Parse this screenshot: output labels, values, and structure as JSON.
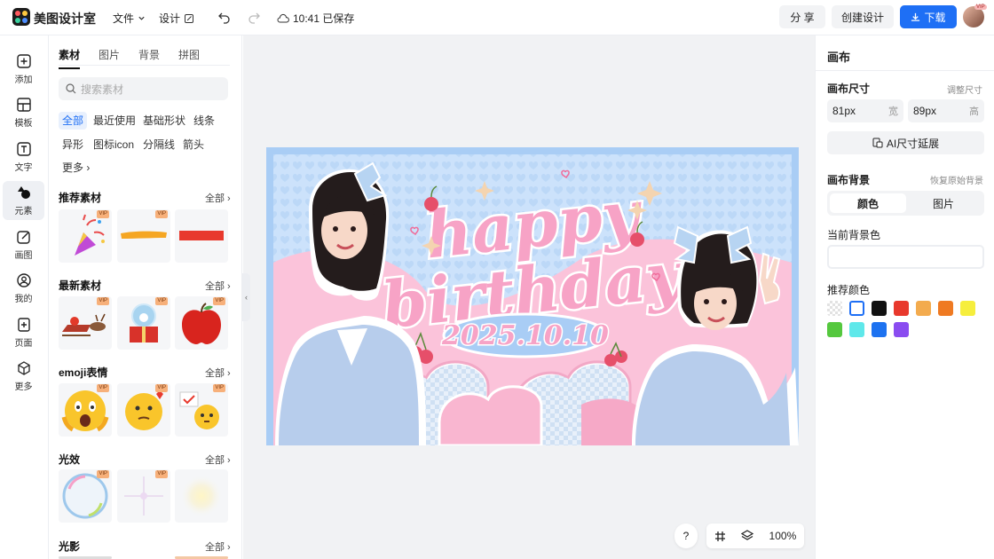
{
  "topbar": {
    "app_name": "美图设计室",
    "menu_file": "文件",
    "menu_design": "设计",
    "save_status": "10:41 已保存",
    "share_label": "分 享",
    "create_label": "创建设计",
    "download_label": "下载",
    "vip_badge": "VIP"
  },
  "leftrail": {
    "items": [
      {
        "label": "添加",
        "icon": "plus-square-icon"
      },
      {
        "label": "模板",
        "icon": "template-icon"
      },
      {
        "label": "文字",
        "icon": "text-icon"
      },
      {
        "label": "元素",
        "icon": "shapes-icon"
      },
      {
        "label": "画图",
        "icon": "pencil-icon"
      },
      {
        "label": "我的",
        "icon": "user-icon"
      },
      {
        "label": "页面",
        "icon": "page-add-icon"
      },
      {
        "label": "更多",
        "icon": "cube-icon"
      }
    ]
  },
  "panel": {
    "tabs": [
      "素材",
      "图片",
      "背景",
      "拼图"
    ],
    "search_placeholder": "搜索素材",
    "chips": [
      "全部",
      "最近使用",
      "基础形状",
      "线条",
      "异形",
      "图标icon",
      "分隔线",
      "箭头",
      "更多"
    ],
    "sections": [
      {
        "title": "推荐素材",
        "more": "全部"
      },
      {
        "title": "最新素材",
        "more": "全部"
      },
      {
        "title": "emoji表情",
        "more": "全部"
      },
      {
        "title": "光效",
        "more": "全部"
      },
      {
        "title": "光影",
        "more": "全部"
      }
    ],
    "vip_label": "VIP"
  },
  "canvas": {
    "headline_1": "happy",
    "headline_2": "birthday",
    "date": "2025.10.10",
    "zoom": "100%",
    "help": "?"
  },
  "rpanel": {
    "title": "画布",
    "size_label": "画布尺寸",
    "resize_link": "调整尺寸",
    "width_value": "81px",
    "width_unit": "宽",
    "height_value": "89px",
    "height_unit": "高",
    "ai_extend": "AI尺寸延展",
    "bg_label": "画布背景",
    "restore_bg": "恢复原始背景",
    "seg_color": "颜色",
    "seg_image": "图片",
    "current_bg": "当前背景色",
    "recommend": "推荐颜色",
    "swatches": [
      "transparent",
      "#ffffff",
      "#111111",
      "#e8392d",
      "#f3ab4e",
      "#ef7a22",
      "#f6ee3d",
      "#55c83e",
      "#5fe8ea",
      "#1d72f0",
      "#8a4cf0"
    ]
  }
}
